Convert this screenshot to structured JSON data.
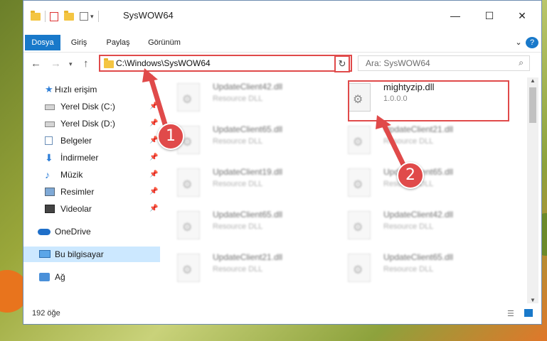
{
  "window": {
    "title": "SysWOW64",
    "minimize_glyph": "—",
    "maximize_glyph": "☐",
    "close_glyph": "✕",
    "help_glyph": "?",
    "expand_glyph": "⌄"
  },
  "ribbon": {
    "tabs": [
      "Dosya",
      "Giriş",
      "Paylaş",
      "Görünüm"
    ]
  },
  "address": {
    "path": "C:\\Windows\\SysWOW64",
    "search_placeholder": "Ara: SysWOW64"
  },
  "sidebar": {
    "items": [
      {
        "label": "Hızlı erişim",
        "icon": "star-icon",
        "pinned": false
      },
      {
        "label": "Yerel Disk (C:)",
        "icon": "drive-icon",
        "pinned": true
      },
      {
        "label": "Yerel Disk (D:)",
        "icon": "drive-icon",
        "pinned": true
      },
      {
        "label": "Belgeler",
        "icon": "documents-icon",
        "pinned": true
      },
      {
        "label": "İndirmeler",
        "icon": "download-icon",
        "pinned": true
      },
      {
        "label": "Müzik",
        "icon": "music-icon",
        "pinned": true
      },
      {
        "label": "Resimler",
        "icon": "pictures-icon",
        "pinned": true
      },
      {
        "label": "Videolar",
        "icon": "video-icon",
        "pinned": true
      },
      {
        "label": "OneDrive",
        "icon": "cloud-icon",
        "pinned": false
      },
      {
        "label": "Bu bilgisayar",
        "icon": "computer-icon",
        "pinned": false
      },
      {
        "label": "Ağ",
        "icon": "network-icon",
        "pinned": false
      }
    ]
  },
  "files": [
    {
      "name": "UpdateClient42.dll",
      "sub": "Resource DLL"
    },
    {
      "name": "mightyzip.dll",
      "sub": "1.0.0.0"
    },
    {
      "name": "UpdateClient65.dll",
      "sub": "Resource DLL"
    },
    {
      "name": "UpdateClient21.dll",
      "sub": "Resource DLL"
    },
    {
      "name": "UpdateClient19.dll",
      "sub": "Resource DLL"
    },
    {
      "name": "UpdateClient65.dll",
      "sub": "Resource DLL"
    },
    {
      "name": "UpdateClient65.dll",
      "sub": "Resource DLL"
    },
    {
      "name": "UpdateClient42.dll",
      "sub": "Resource DLL"
    },
    {
      "name": "UpdateClient21.dll",
      "sub": "Resource DLL"
    },
    {
      "name": "UpdateClient65.dll",
      "sub": "Resource DLL"
    }
  ],
  "status": {
    "count": "192 öğe"
  },
  "annotations": {
    "badge1": "1",
    "badge2": "2",
    "color": "#e04a4a"
  }
}
